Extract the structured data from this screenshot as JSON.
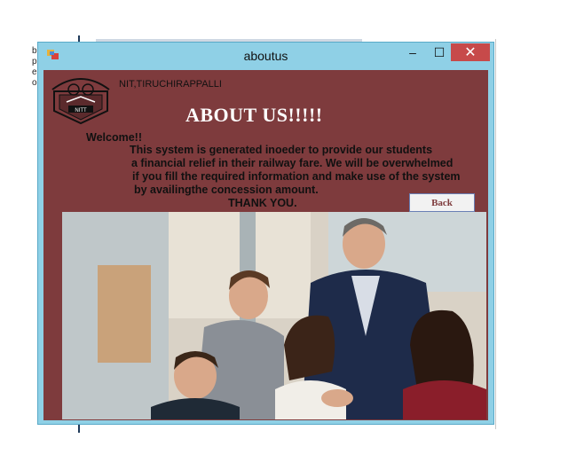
{
  "background": {
    "left_letters": [
      "b",
      "p",
      "e",
      "o"
    ]
  },
  "window": {
    "title": "aboutus",
    "controls": {
      "minimize": "–",
      "maximize": "☐",
      "close": "✕"
    },
    "accent_color": "#8fd0e6",
    "client_color": "#7e3b3d"
  },
  "content": {
    "institution": "NIT,TIRUCHIRAPPALLI",
    "logo_text": "NITT",
    "heading": "ABOUT US!!!!!",
    "lines": [
      "Welcome!!",
      "This system is generated inoeder to provide our students",
      "a financial relief in their railway fare. We will be overwhelmed",
      "if you fill the required information and make use of the system",
      "by availingthe concession amount.",
      "THANK YOU."
    ],
    "back_label": "Back"
  }
}
